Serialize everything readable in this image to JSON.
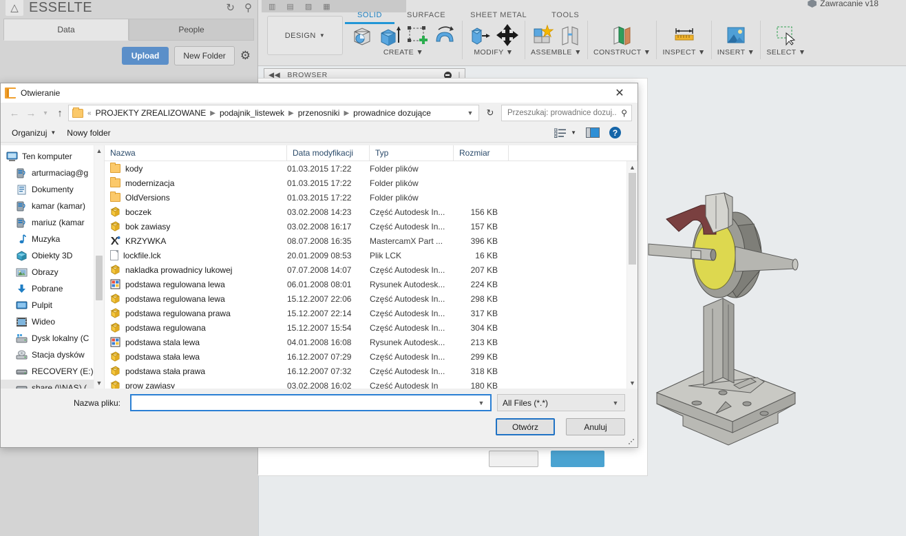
{
  "fusion": {
    "data_panel": {
      "logo_icon": "autodesk-a-icon",
      "title": "ESSELTE",
      "refresh_icon": "refresh-icon",
      "search_icon": "search-icon",
      "tabs": [
        {
          "label": "Data",
          "active": true
        },
        {
          "label": "People",
          "active": false
        }
      ],
      "upload_label": "Upload",
      "new_folder_label": "New Folder",
      "settings_icon": "gear-icon"
    },
    "document_name": "Zawracanie v18",
    "ribbon": {
      "workspace_label": "DESIGN",
      "tabs": [
        {
          "label": "SOLID",
          "active": true
        },
        {
          "label": "SURFACE",
          "active": false
        },
        {
          "label": "SHEET METAL",
          "active": false
        },
        {
          "label": "TOOLS",
          "active": false
        }
      ],
      "groups": [
        {
          "label": "CREATE",
          "icons": [
            "sketch-icon",
            "extrude-icon",
            "create-sketch-icon",
            "revolve-icon"
          ]
        },
        {
          "label": "MODIFY",
          "icons": [
            "press-pull-icon",
            "move-copy-icon"
          ]
        },
        {
          "label": "ASSEMBLE",
          "icons": [
            "new-component-icon",
            "joint-icon"
          ]
        },
        {
          "label": "CONSTRUCT",
          "icons": [
            "offset-plane-icon"
          ]
        },
        {
          "label": "INSPECT",
          "icons": [
            "measure-icon"
          ]
        },
        {
          "label": "INSERT",
          "icons": [
            "insert-image-icon"
          ]
        },
        {
          "label": "SELECT",
          "icons": [
            "select-window-icon"
          ]
        }
      ]
    },
    "browser": {
      "collapse_icon": "collapse-left-icon",
      "label": "BROWSER",
      "minimize_icon": "minimize-icon"
    }
  },
  "dialog": {
    "title": "Otwieranie",
    "title_icon": "folder-open-icon",
    "close_icon": "close-icon",
    "nav": {
      "back_icon": "back-arrow-icon",
      "forward_icon": "forward-arrow-icon",
      "recent_icon": "chevron-down-icon",
      "up_icon": "up-arrow-icon",
      "folder_icon": "folder-icon",
      "overflow": "«",
      "breadcrumbs": [
        "PROJEKTY ZREALIZOWANE",
        "podajnik_listewek",
        "przenosniki",
        "prowadnice dozujące"
      ],
      "dropdown_icon": "chevron-down-icon",
      "refresh_icon": "refresh-icon"
    },
    "search": {
      "placeholder": "Przeszukaj: prowadnice dozuj...",
      "value": "",
      "icon": "search-icon"
    },
    "toolbar": {
      "organize_label": "Organizuj",
      "organize_caret": "▼",
      "new_folder_label": "Nowy folder",
      "view_icon": "view-list-icon",
      "view_caret": "▼",
      "preview_pane_icon": "preview-pane-icon",
      "help_icon": "help-icon"
    },
    "nav_pane": {
      "scroll_up_icon": "chevron-up-icon",
      "scroll_down_icon": "chevron-down-icon",
      "items": [
        {
          "label": "Ten komputer",
          "icon": "computer-icon",
          "level": 0,
          "state": "normal"
        },
        {
          "label": "arturmaciag@g",
          "icon": "user-folder-icon",
          "level": 1,
          "state": "normal"
        },
        {
          "label": "Dokumenty",
          "icon": "documents-icon",
          "level": 1,
          "state": "normal"
        },
        {
          "label": "kamar (kamar)",
          "icon": "user-folder-icon",
          "level": 1,
          "state": "normal"
        },
        {
          "label": "mariuz (kamar",
          "icon": "user-folder-icon",
          "level": 1,
          "state": "normal"
        },
        {
          "label": "Muzyka",
          "icon": "music-icon",
          "level": 1,
          "state": "normal"
        },
        {
          "label": "Obiekty 3D",
          "icon": "objects3d-icon",
          "level": 1,
          "state": "normal"
        },
        {
          "label": "Obrazy",
          "icon": "pictures-icon",
          "level": 1,
          "state": "normal"
        },
        {
          "label": "Pobrane",
          "icon": "downloads-icon",
          "level": 1,
          "state": "normal"
        },
        {
          "label": "Pulpit",
          "icon": "desktop-icon",
          "level": 1,
          "state": "normal"
        },
        {
          "label": "Wideo",
          "icon": "videos-icon",
          "level": 1,
          "state": "normal"
        },
        {
          "label": "Dysk lokalny (C",
          "icon": "drive-icon",
          "level": 1,
          "state": "normal"
        },
        {
          "label": "Stacja dysków",
          "icon": "optical-drive-icon",
          "level": 1,
          "state": "normal"
        },
        {
          "label": "RECOVERY (E:)",
          "icon": "drive-icon",
          "level": 1,
          "state": "normal"
        },
        {
          "label": "share (\\\\NAS) (",
          "icon": "network-drive-icon",
          "level": 1,
          "state": "hover"
        }
      ]
    },
    "file_list": {
      "columns": [
        {
          "label": "Nazwa",
          "sorted": true
        },
        {
          "label": "Data modyfikacji",
          "sorted": false
        },
        {
          "label": "Typ",
          "sorted": false
        },
        {
          "label": "Rozmiar",
          "sorted": false
        }
      ],
      "rows": [
        {
          "name": "kody",
          "date": "01.03.2015 17:22",
          "type": "Folder plików",
          "size": "",
          "icon": "folder-icon"
        },
        {
          "name": "modernizacja",
          "date": "01.03.2015 17:22",
          "type": "Folder plików",
          "size": "",
          "icon": "folder-icon"
        },
        {
          "name": "OldVersions",
          "date": "01.03.2015 17:22",
          "type": "Folder plików",
          "size": "",
          "icon": "folder-icon"
        },
        {
          "name": "boczek",
          "date": "03.02.2008 14:23",
          "type": "Część Autodesk In...",
          "size": "156 KB",
          "icon": "inventor-part-icon"
        },
        {
          "name": "bok zawiasy",
          "date": "03.02.2008 16:17",
          "type": "Część Autodesk In...",
          "size": "157 KB",
          "icon": "inventor-part-icon"
        },
        {
          "name": "KRZYWKA",
          "date": "08.07.2008 16:35",
          "type": "MastercamX Part ...",
          "size": "396 KB",
          "icon": "mastercam-icon"
        },
        {
          "name": "lockfile.lck",
          "date": "20.01.2009 08:53",
          "type": "Plik LCK",
          "size": "16 KB",
          "icon": "generic-file-icon"
        },
        {
          "name": "nakladka prowadnicy lukowej",
          "date": "07.07.2008 14:07",
          "type": "Część Autodesk In...",
          "size": "207 KB",
          "icon": "inventor-part-icon"
        },
        {
          "name": "podstawa regulowana lewa",
          "date": "06.01.2008 08:01",
          "type": "Rysunek Autodesk...",
          "size": "224 KB",
          "icon": "inventor-drawing-icon"
        },
        {
          "name": "podstawa regulowana lewa",
          "date": "15.12.2007 22:06",
          "type": "Część Autodesk In...",
          "size": "298 KB",
          "icon": "inventor-part-icon"
        },
        {
          "name": "podstawa regulowana prawa",
          "date": "15.12.2007 22:14",
          "type": "Część Autodesk In...",
          "size": "317 KB",
          "icon": "inventor-part-icon"
        },
        {
          "name": "podstawa regulowana",
          "date": "15.12.2007 15:54",
          "type": "Część Autodesk In...",
          "size": "304 KB",
          "icon": "inventor-part-icon"
        },
        {
          "name": "podstawa stala lewa",
          "date": "04.01.2008 16:08",
          "type": "Rysunek Autodesk...",
          "size": "213 KB",
          "icon": "inventor-drawing-icon"
        },
        {
          "name": "podstawa stała lewa",
          "date": "16.12.2007 07:29",
          "type": "Część Autodesk In...",
          "size": "299 KB",
          "icon": "inventor-part-icon"
        },
        {
          "name": "podstawa stała prawa",
          "date": "16.12.2007 07:32",
          "type": "Część Autodesk In...",
          "size": "318 KB",
          "icon": "inventor-part-icon"
        },
        {
          "name": "prow zawiasy",
          "date": "03.02.2008 16:02",
          "type": "Część Autodesk In",
          "size": "180 KB",
          "icon": "inventor-part-icon"
        }
      ],
      "scroll_up_icon": "chevron-up-icon",
      "scroll_down_icon": "chevron-down-icon"
    },
    "footer": {
      "filename_label": "Nazwa pliku:",
      "filename_value": "",
      "filename_dropdown_icon": "chevron-down-icon",
      "filter_value": "All Files (*.*)",
      "filter_dropdown_icon": "chevron-down-icon",
      "open_label": "Otwórz",
      "cancel_label": "Anuluj",
      "resize_grip": "resize-grip-icon"
    }
  }
}
